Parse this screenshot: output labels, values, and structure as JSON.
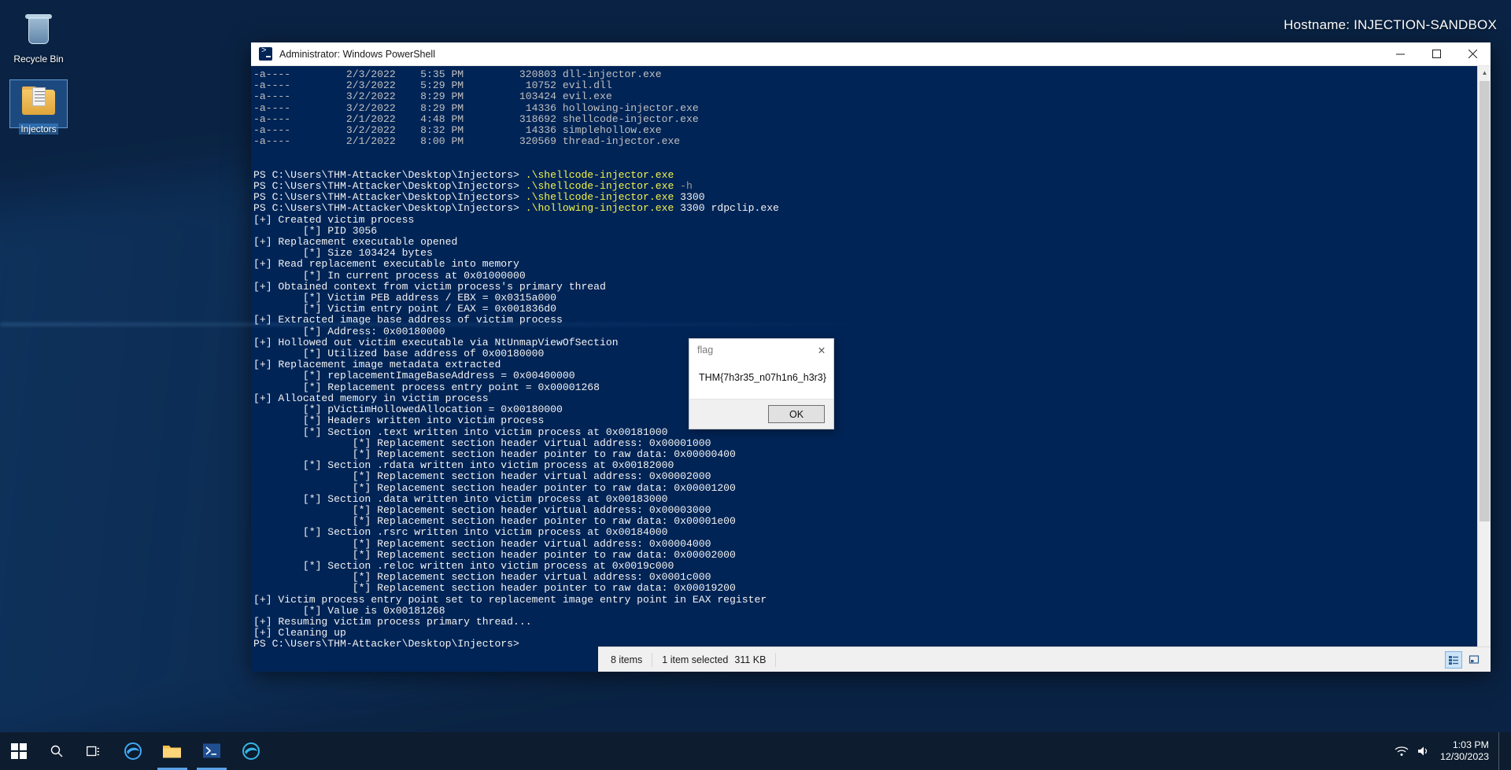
{
  "desktop": {
    "hostname_label": "Hostname: INJECTION-SANDBOX",
    "icons": [
      {
        "name": "recycle-bin",
        "label": "Recycle Bin",
        "selected": false
      },
      {
        "name": "injectors-folder",
        "label": "Injectors",
        "selected": true
      }
    ]
  },
  "powershell": {
    "title": "Administrator: Windows PowerShell",
    "window_buttons": {
      "minimize": "–",
      "maximize": "□",
      "close": "✕"
    },
    "scrollbar": {
      "up_arrow": "▲",
      "down_arrow": "▼"
    },
    "console_lines": [
      {
        "text": "-a----         2/3/2022    5:35 PM         320803 dll-injector.exe",
        "class": "c-gray"
      },
      {
        "text": "-a----         2/3/2022    5:29 PM          10752 evil.dll",
        "class": "c-gray"
      },
      {
        "text": "-a----         3/2/2022    8:29 PM         103424 evil.exe",
        "class": "c-gray"
      },
      {
        "text": "-a----         3/2/2022    8:29 PM          14336 hollowing-injector.exe",
        "class": "c-gray"
      },
      {
        "text": "-a----         2/1/2022    4:48 PM         318692 shellcode-injector.exe",
        "class": "c-gray"
      },
      {
        "text": "-a----         3/2/2022    8:32 PM          14336 simplehollow.exe",
        "class": "c-gray"
      },
      {
        "text": "-a----         2/1/2022    8:00 PM         320569 thread-injector.exe",
        "class": "c-gray"
      },
      {
        "text": "",
        "class": "c-gray"
      },
      {
        "text": "",
        "class": "c-gray"
      },
      {
        "segments": [
          {
            "text": "PS C:\\Users\\THM-Attacker\\Desktop\\Injectors> ",
            "class": "c-white"
          },
          {
            "text": ".\\shellcode-injector.exe",
            "class": "c-yellow"
          }
        ]
      },
      {
        "segments": [
          {
            "text": "PS C:\\Users\\THM-Attacker\\Desktop\\Injectors> ",
            "class": "c-white"
          },
          {
            "text": ".\\shellcode-injector.exe",
            "class": "c-yellow"
          },
          {
            "text": " -h",
            "class": "c-dim"
          }
        ]
      },
      {
        "segments": [
          {
            "text": "PS C:\\Users\\THM-Attacker\\Desktop\\Injectors> ",
            "class": "c-white"
          },
          {
            "text": ".\\shellcode-injector.exe",
            "class": "c-yellow"
          },
          {
            "text": " 3300",
            "class": "c-white"
          }
        ]
      },
      {
        "segments": [
          {
            "text": "PS C:\\Users\\THM-Attacker\\Desktop\\Injectors> ",
            "class": "c-white"
          },
          {
            "text": ".\\hollowing-injector.exe",
            "class": "c-yellow"
          },
          {
            "text": " 3300 rdpclip.exe",
            "class": "c-white"
          }
        ]
      },
      {
        "text": "[+] Created victim process",
        "class": "c-white"
      },
      {
        "text": "        [*] PID 3056",
        "class": "c-white"
      },
      {
        "text": "[+] Replacement executable opened",
        "class": "c-white"
      },
      {
        "text": "        [*] Size 103424 bytes",
        "class": "c-white"
      },
      {
        "text": "[+] Read replacement executable into memory",
        "class": "c-white"
      },
      {
        "text": "        [*] In current process at 0x01000000",
        "class": "c-white"
      },
      {
        "text": "[+] Obtained context from victim process's primary thread",
        "class": "c-white"
      },
      {
        "text": "        [*] Victim PEB address / EBX = 0x0315a000",
        "class": "c-white"
      },
      {
        "text": "        [*] Victim entry point / EAX = 0x001836d0",
        "class": "c-white"
      },
      {
        "text": "[+] Extracted image base address of victim process",
        "class": "c-white"
      },
      {
        "text": "        [*] Address: 0x00180000",
        "class": "c-white"
      },
      {
        "text": "[+] Hollowed out victim executable via NtUnmapViewOfSection",
        "class": "c-white"
      },
      {
        "text": "        [*] Utilized base address of 0x00180000",
        "class": "c-white"
      },
      {
        "text": "[+] Replacement image metadata extracted",
        "class": "c-white"
      },
      {
        "text": "        [*] replacementImageBaseAddress = 0x00400000",
        "class": "c-white"
      },
      {
        "text": "        [*] Replacement process entry point = 0x00001268",
        "class": "c-white"
      },
      {
        "text": "[+] Allocated memory in victim process",
        "class": "c-white"
      },
      {
        "text": "        [*] pVictimHollowedAllocation = 0x00180000",
        "class": "c-white"
      },
      {
        "text": "        [*] Headers written into victim process",
        "class": "c-white"
      },
      {
        "text": "        [*] Section .text written into victim process at 0x00181000",
        "class": "c-white"
      },
      {
        "text": "                [*] Replacement section header virtual address: 0x00001000",
        "class": "c-white"
      },
      {
        "text": "                [*] Replacement section header pointer to raw data: 0x00000400",
        "class": "c-white"
      },
      {
        "text": "        [*] Section .rdata written into victim process at 0x00182000",
        "class": "c-white"
      },
      {
        "text": "                [*] Replacement section header virtual address: 0x00002000",
        "class": "c-white"
      },
      {
        "text": "                [*] Replacement section header pointer to raw data: 0x00001200",
        "class": "c-white"
      },
      {
        "text": "        [*] Section .data written into victim process at 0x00183000",
        "class": "c-white"
      },
      {
        "text": "                [*] Replacement section header virtual address: 0x00003000",
        "class": "c-white"
      },
      {
        "text": "                [*] Replacement section header pointer to raw data: 0x00001e00",
        "class": "c-white"
      },
      {
        "text": "        [*] Section .rsrc written into victim process at 0x00184000",
        "class": "c-white"
      },
      {
        "text": "                [*] Replacement section header virtual address: 0x00004000",
        "class": "c-white"
      },
      {
        "text": "                [*] Replacement section header pointer to raw data: 0x00002000",
        "class": "c-white"
      },
      {
        "text": "        [*] Section .reloc written into victim process at 0x0019c000",
        "class": "c-white"
      },
      {
        "text": "                [*] Replacement section header virtual address: 0x0001c000",
        "class": "c-white"
      },
      {
        "text": "                [*] Replacement section header pointer to raw data: 0x00019200",
        "class": "c-white"
      },
      {
        "text": "[+] Victim process entry point set to replacement image entry point in EAX register",
        "class": "c-white"
      },
      {
        "text": "        [*] Value is 0x00181268",
        "class": "c-white"
      },
      {
        "text": "[+] Resuming victim process primary thread...",
        "class": "c-white"
      },
      {
        "text": "[+] Cleaning up",
        "class": "c-white"
      },
      {
        "text": "PS C:\\Users\\THM-Attacker\\Desktop\\Injectors>",
        "class": "c-white"
      }
    ]
  },
  "flag_dialog": {
    "title": "flag",
    "close_glyph": "✕",
    "message": "THM{7h3r35_n07h1n6_h3r3}",
    "ok_label": "OK"
  },
  "explorer_status": {
    "item_count": "8 items",
    "selection": "1 item selected",
    "size": "311 KB"
  },
  "taskbar": {
    "start": "windows-logo",
    "buttons": [
      {
        "name": "search-icon"
      },
      {
        "name": "task-view-icon"
      },
      {
        "name": "edge-legacy-icon"
      },
      {
        "name": "file-explorer-icon"
      },
      {
        "name": "powershell-icon"
      },
      {
        "name": "edge-icon"
      }
    ],
    "time": "1:03 PM",
    "date": "12/30/2023"
  }
}
